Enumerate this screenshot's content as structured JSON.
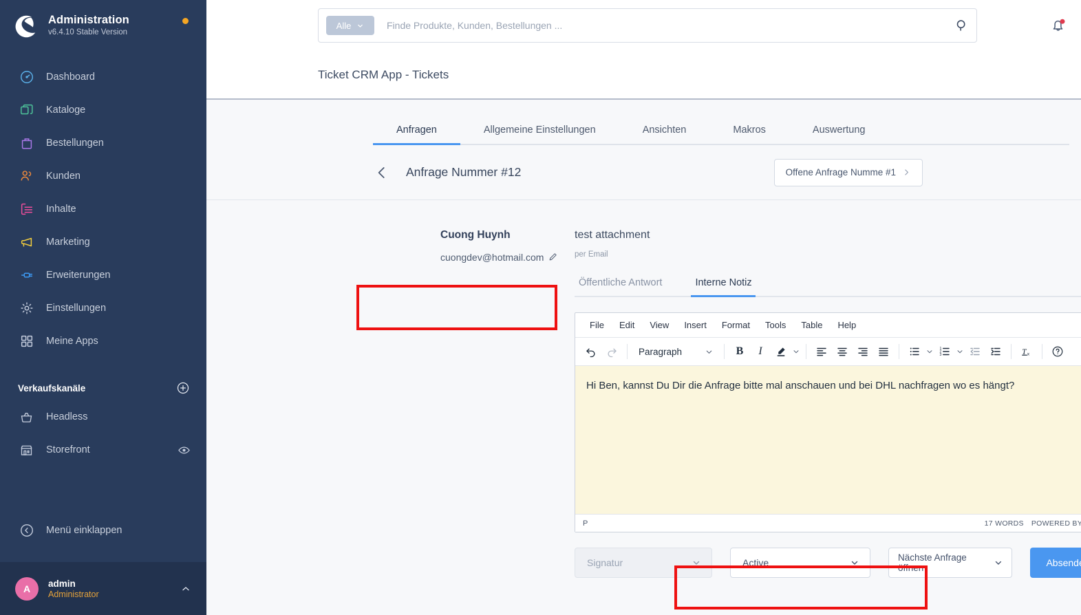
{
  "sidebar": {
    "brand": {
      "title": "Administration",
      "version": "v6.4.10 Stable Version"
    },
    "items": [
      {
        "label": "Dashboard",
        "icon": "gauge-icon",
        "color": "#5ab0e8"
      },
      {
        "label": "Kataloge",
        "icon": "catalog-icon",
        "color": "#4ec59a"
      },
      {
        "label": "Bestellungen",
        "icon": "bag-icon",
        "color": "#a978e8"
      },
      {
        "label": "Kunden",
        "icon": "users-icon",
        "color": "#f08a3c"
      },
      {
        "label": "Inhalte",
        "icon": "content-icon",
        "color": "#f04e9b"
      },
      {
        "label": "Marketing",
        "icon": "megaphone-icon",
        "color": "#f5cf3d"
      },
      {
        "label": "Erweiterungen",
        "icon": "plug-icon",
        "color": "#3d9bf5"
      },
      {
        "label": "Einstellungen",
        "icon": "gear-icon",
        "color": "#c6cede"
      },
      {
        "label": "Meine Apps",
        "icon": "grid-icon",
        "color": "#c6cede"
      }
    ],
    "section": {
      "title": "Verkaufskanäle",
      "add_icon": "plus-circle-icon"
    },
    "channels": [
      {
        "label": "Headless",
        "icon": "basket-icon",
        "trailing_icon": ""
      },
      {
        "label": "Storefront",
        "icon": "shop-icon",
        "trailing_icon": "eye-icon"
      }
    ],
    "collapse": {
      "label": "Menü einklappen",
      "icon": "chevron-left-circle-icon"
    },
    "user": {
      "initial": "A",
      "name": "admin",
      "role": "Administrator",
      "caret_icon": "chevron-up-icon"
    }
  },
  "topbar": {
    "scope_label": "Alle",
    "scope_caret_icon": "chevron-down-icon",
    "search_placeholder": "Finde Produkte, Kunden, Bestellungen ...",
    "search_value": "",
    "search_icon": "search-icon",
    "bell_icon": "bell-icon",
    "bell_badge": true
  },
  "page": {
    "title": "Ticket CRM App - Tickets"
  },
  "tabs": {
    "items": [
      {
        "label": "Anfragen",
        "active": true
      },
      {
        "label": "Allgemeine Einstellungen",
        "active": false
      },
      {
        "label": "Ansichten",
        "active": false
      },
      {
        "label": "Makros",
        "active": false
      },
      {
        "label": "Auswertung",
        "active": false
      }
    ]
  },
  "ticket_nav": {
    "back_icon": "chevron-left-icon",
    "title": "Anfrage Nummer #12",
    "next_label": "Offene Anfrage Numme #1",
    "next_icon": "chevron-right-icon"
  },
  "customer": {
    "name": "Cuong Huynh",
    "email": "cuongdev@hotmail.com",
    "edit_icon": "pencil-icon"
  },
  "conversation": {
    "subject": "test attachment",
    "channel": "per Email",
    "reply_tabs": [
      {
        "label": "Öffentliche Antwort",
        "active": false
      },
      {
        "label": "Interne Notiz",
        "active": true
      }
    ]
  },
  "editor": {
    "menubar": [
      "File",
      "Edit",
      "View",
      "Insert",
      "Format",
      "Tools",
      "Table",
      "Help"
    ],
    "toolbar": {
      "undo_icon": "undo-icon",
      "redo_icon": "redo-icon",
      "format_label": "Paragraph",
      "format_caret_icon": "chevron-down-icon",
      "bold_label": "B",
      "italic_label": "I",
      "highlight_icon": "highlight-pen-icon",
      "highlight_caret_icon": "chevron-down-icon",
      "align_left_icon": "align-left-icon",
      "align_center_icon": "align-center-icon",
      "align_right_icon": "align-right-icon",
      "align_justify_icon": "align-justify-icon",
      "bullet_list_icon": "bullet-list-icon",
      "bullet_caret_icon": "chevron-down-icon",
      "numbered_list_icon": "numbered-list-icon",
      "numbered_caret_icon": "chevron-down-icon",
      "outdent_icon": "outdent-icon",
      "indent_icon": "indent-icon",
      "clear_format_icon": "clear-formatting-icon",
      "help_icon": "help-circle-icon"
    },
    "content": "Hi Ben, kannst Du Dir die Anfrage bitte mal anschauen und bei DHL nachfragen wo es hängt?",
    "status": {
      "path": "P",
      "words": "17 WORDS",
      "branding": "POWERED BY TINY",
      "resize_icon": "resize-handle-icon"
    }
  },
  "actions": {
    "signature_label": "Signatur",
    "signature_caret_icon": "chevron-down-icon",
    "status_label": "Active",
    "status_caret_icon": "chevron-down-icon",
    "next_action_label": "Nächste Anfrage öffnen",
    "next_action_caret_icon": "chevron-down-icon",
    "submit_label": "Absenden"
  },
  "colors": {
    "sidebar_bg": "#293c5c",
    "sidebar_user_bg": "#22324e",
    "accent_blue": "#4a97f0",
    "highlight_red": "#ee1111",
    "editor_bg": "#fbf6dd",
    "page_bg": "#f7f8fa",
    "avatar": "#e96fa8",
    "role_orange": "#e6a33b"
  }
}
